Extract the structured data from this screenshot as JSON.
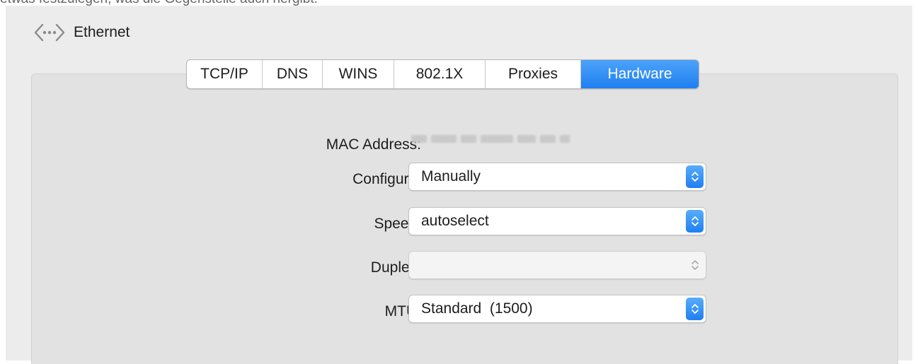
{
  "caption": "etwas festzulegen, was die Gegenstelle auch hergibt.",
  "service": {
    "icon": "ethernet-icon",
    "name": "Ethernet"
  },
  "tabs": [
    {
      "label": "TCP/IP",
      "active": false
    },
    {
      "label": "DNS",
      "active": false
    },
    {
      "label": "WINS",
      "active": false
    },
    {
      "label": "802.1X",
      "active": false
    },
    {
      "label": "Proxies",
      "active": false
    },
    {
      "label": "Hardware",
      "active": true
    }
  ],
  "hardware": {
    "mac_address_label": "MAC Address:",
    "configure_label": "Configure:",
    "configure_value": "Manually",
    "speed_label": "Speed:",
    "speed_value": "autoselect",
    "duplex_label": "Duplex:",
    "duplex_value": "",
    "mtu_label": "MTU:",
    "mtu_value": "Standard  (1500)"
  },
  "colors": {
    "accent": "#1f7ff1",
    "panel": "#e2e2e2",
    "window": "#ececec"
  }
}
